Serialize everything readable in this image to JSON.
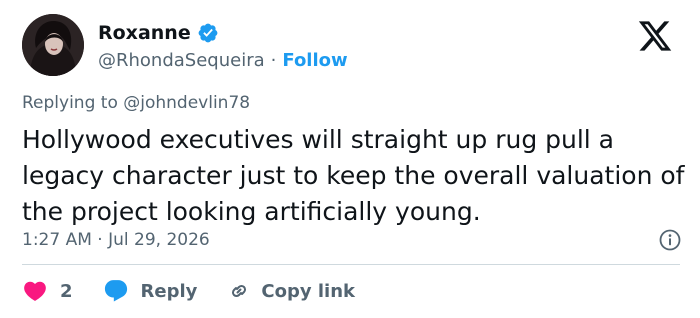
{
  "author": {
    "name": "Roxanne",
    "handle": "@RhondaSequeira",
    "separator": "·",
    "follow_label": "Follow"
  },
  "reply_context": {
    "prefix": "Replying to",
    "handle": "@johndevlin78"
  },
  "tweet": {
    "text": "Hollywood executives will straight up rug pull a legacy character just to keep the overall valuation of the project looking artificially young.",
    "timestamp": "1:27 AM · Jul 29, 2026"
  },
  "actions": {
    "like_count": "2",
    "reply_label": "Reply",
    "copy_label": "Copy link"
  },
  "colors": {
    "accent": "#1d9bf0",
    "like": "#f91880",
    "text": "#0f1419",
    "muted": "#536471"
  },
  "icons": {
    "verified": "verified-badge-icon",
    "logo": "x-logo-icon",
    "info": "info-icon",
    "like": "heart-icon",
    "reply": "speech-bubble-icon",
    "copy": "link-icon"
  }
}
